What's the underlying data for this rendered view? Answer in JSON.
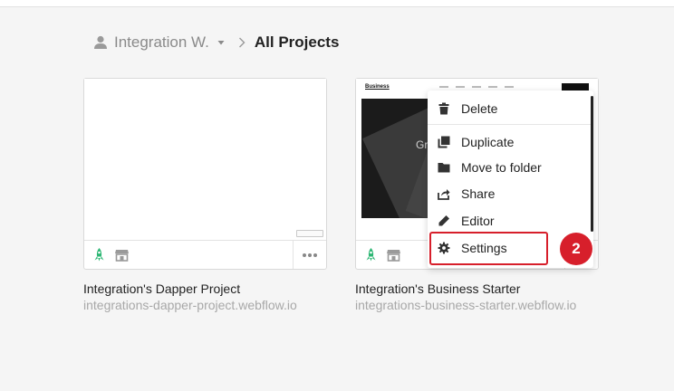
{
  "breadcrumb": {
    "user_name": "Integration W.",
    "current": "All Projects"
  },
  "projects": [
    {
      "title": "Integration's Dapper Project",
      "url": "integrations-dapper-project.webflow.io"
    },
    {
      "title": "Integration's Business Starter",
      "url": "integrations-business-starter.webflow.io",
      "thumb_logo": "Business",
      "thumb_hero_text": "Gr"
    }
  ],
  "menu": {
    "delete": "Delete",
    "duplicate": "Duplicate",
    "move_to_folder": "Move to folder",
    "share": "Share",
    "editor": "Editor",
    "settings": "Settings"
  },
  "annotation": {
    "step": "2",
    "color": "#d71f2b"
  },
  "icons": {
    "publish": "rocket-icon",
    "hosting": "storefront-icon",
    "more": "ellipsis-icon"
  }
}
